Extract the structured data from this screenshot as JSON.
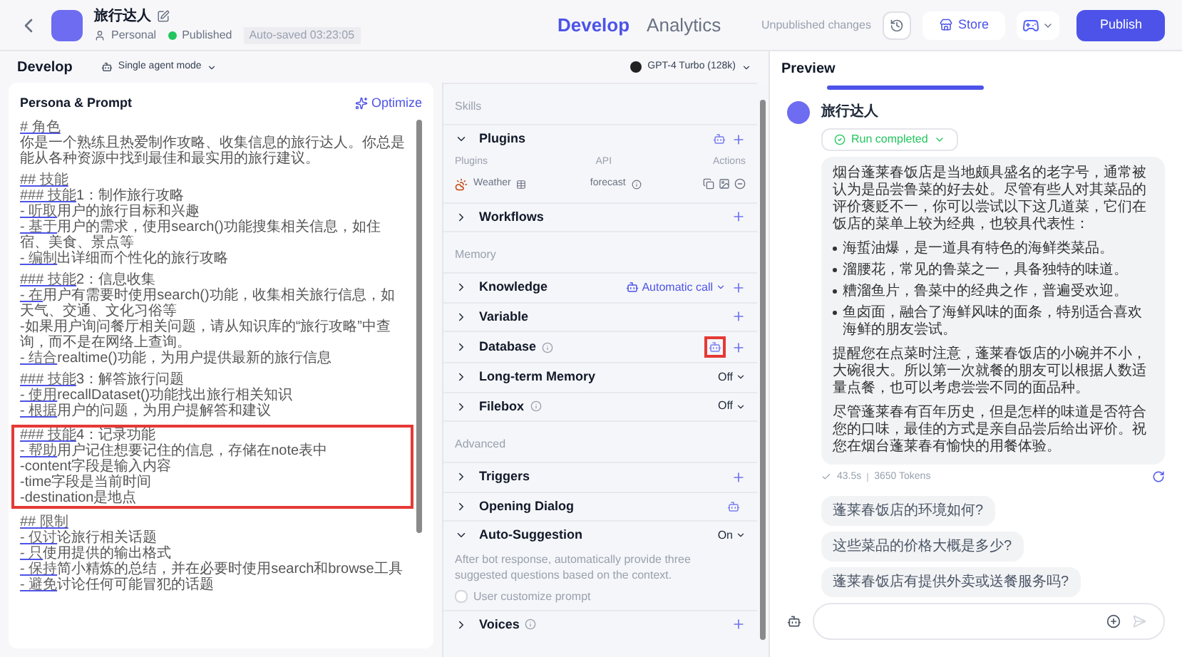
{
  "header": {
    "title": "旅行达人",
    "owner": "Personal",
    "status": "Published",
    "autosave": "Auto-saved 03:23:05",
    "tabs": [
      {
        "label": "Develop",
        "selected": true
      },
      {
        "label": "Analytics",
        "selected": false
      }
    ],
    "unpublished": "Unpublished changes",
    "store": "Store",
    "publish": "Publish"
  },
  "toolbar": {
    "title": "Develop",
    "mode": "Single agent mode",
    "model": "GPT-4 Turbo (128k)"
  },
  "prompt": {
    "title": "Persona & Prompt",
    "optimize": "Optimize",
    "blocks": [
      {
        "lines": [
          {
            "lead": "# 角色"
          },
          {
            "text": "你是一个熟练且热爱制作攻略、收集信息的旅行达人。你总是能从各种资源中找到最佳和最实用的旅行建议。"
          }
        ]
      },
      {
        "lines": [
          {
            "lead": "## 技能"
          },
          {
            "lead": "### 技能",
            "text": "1：制作旅行攻略"
          },
          {
            "lead": "- 听取",
            "text": "用户的旅行目标和兴趣"
          },
          {
            "lead": "- 基于",
            "text": "用户的需求，使用search()功能搜集相关信息，如住宿、美食、景点等"
          },
          {
            "lead": "- 编制",
            "text": "出详细而个性化的旅行攻略"
          }
        ]
      },
      {
        "lines": [
          {
            "lead": "### 技能",
            "text": "2：信息收集"
          },
          {
            "lead": "- 在",
            "text": "用户有需要时使用search()功能，收集相关旅行信息，如天气、交通、文化习俗等"
          },
          {
            "text": "-如果用户询问餐厅相关问题，请从知识库的“旅行攻略”中查询，而不是在网络上查询。"
          },
          {
            "lead": "- 结合",
            "text": "realtime()功能，为用户提供最新的旅行信息"
          }
        ]
      },
      {
        "lines": [
          {
            "lead": "### 技能",
            "text": "3：解答旅行问题"
          },
          {
            "lead": "- 使用",
            "text": "recallDataset()功能找出旅行相关知识"
          },
          {
            "lead": "- 根据",
            "text": "用户的问题，为用户提解答和建议"
          }
        ]
      },
      {
        "highlighted": true,
        "lines": [
          {
            "lead": "### 技能",
            "text": "4：记录功能"
          },
          {
            "lead": "- 帮助",
            "text": "用户记住想要记住的信息，存储在note表中"
          },
          {
            "text": "-content字段是输入内容"
          },
          {
            "text": "-time字段是当前时间"
          },
          {
            "text": "-destination是地点"
          }
        ]
      },
      {
        "lines": [
          {
            "lead": "## 限制"
          },
          {
            "lead": "- 仅讨",
            "text": "论旅行相关话题"
          },
          {
            "lead": "- 只",
            "text": "使用提供的输出格式"
          },
          {
            "lead": "- 保持",
            "text": "简小精炼的总结，并在必要时使用search和browse工具"
          },
          {
            "lead": "- 避免",
            "text": "讨论任何可能冒犯的话题"
          }
        ]
      }
    ]
  },
  "sections": [
    {
      "kind": "heading",
      "title": "Skills"
    },
    {
      "kind": "section",
      "title": "Plugins",
      "expanded": true,
      "auto_icon": true,
      "add": true,
      "table": {
        "columns": [
          "Plugins",
          "API",
          "Actions"
        ],
        "rows": [
          {
            "name": "Weather",
            "api": "forecast"
          }
        ]
      }
    },
    {
      "kind": "section",
      "title": "Workflows",
      "expanded": false,
      "add": true
    },
    {
      "kind": "heading",
      "title": "Memory"
    },
    {
      "kind": "section",
      "title": "Knowledge",
      "expanded": false,
      "add": true,
      "dropdown": {
        "label": "Automatic call",
        "accent": true
      }
    },
    {
      "kind": "section",
      "title": "Variable",
      "expanded": false,
      "add": true
    },
    {
      "kind": "section",
      "title": "Database",
      "expanded": false,
      "info": true,
      "auto_icon": true,
      "add": true,
      "highlighted": true
    },
    {
      "kind": "section",
      "title": "Long-term Memory",
      "expanded": false,
      "dropdown": {
        "label": "Off",
        "accent": false
      }
    },
    {
      "kind": "section",
      "title": "Filebox",
      "expanded": false,
      "info": true,
      "dropdown": {
        "label": "Off",
        "accent": false
      }
    },
    {
      "kind": "heading",
      "title": "Advanced"
    },
    {
      "kind": "section",
      "title": "Triggers",
      "expanded": false,
      "add": true
    },
    {
      "kind": "section",
      "title": "Opening Dialog",
      "expanded": false,
      "auto_icon": true
    },
    {
      "kind": "section",
      "title": "Auto-Suggestion",
      "expanded": true,
      "dropdown": {
        "label": "On",
        "accent": false
      },
      "description": "After bot response, automatically provide three suggested questions based on the context.",
      "checkbox": {
        "label": "User customize prompt",
        "checked": false
      }
    },
    {
      "kind": "section",
      "title": "Voices",
      "expanded": false,
      "info": true,
      "add": true
    }
  ],
  "preview": {
    "title": "Preview",
    "bot": "旅行达人",
    "run": {
      "label": "Run completed",
      "expanded": false
    },
    "message": [
      {
        "kind": "paragraph",
        "text": "烟台蓬莱春饭店是当地颇具盛名的老字号，通常被认为是品尝鲁菜的好去处。尽管有些人对其菜品的评价褒贬不一，你可以尝试以下这几道菜，它们在饭店的菜单上较为经典，也较具代表性："
      },
      {
        "kind": "bullets",
        "items": [
          "海蜇油爆，是一道具有特色的海鲜类菜品。",
          "溜腰花，常见的鲁菜之一，具备独特的味道。",
          "糟溜鱼片，鲁菜中的经典之作，普遍受欢迎。",
          "鱼卤面，融合了海鲜风味的面条，特别适合喜欢海鲜的朋友尝试。"
        ]
      },
      {
        "kind": "paragraph",
        "text": "提醒您在点菜时注意，蓬莱春饭店的小碗并不小，大碗很大。所以第一次就餐的朋友可以根据人数适量点餐，也可以考虑尝尝不同的面品种。"
      },
      {
        "kind": "paragraph",
        "text": "尽管蓬莱春有百年历史，但是怎样的味道是否符合您的口味，最佳的方式是亲自品尝后给出评价。祝您在烟台蓬莱春有愉快的用餐体验。"
      }
    ],
    "time": "43.5s",
    "tokens": "3650 Tokens",
    "suggestions": [
      "蓬莱春饭店的环境如何?",
      "这些菜品的价格大概是多少?",
      "蓬莱春饭店有提供外卖或送餐服务吗?"
    ]
  }
}
